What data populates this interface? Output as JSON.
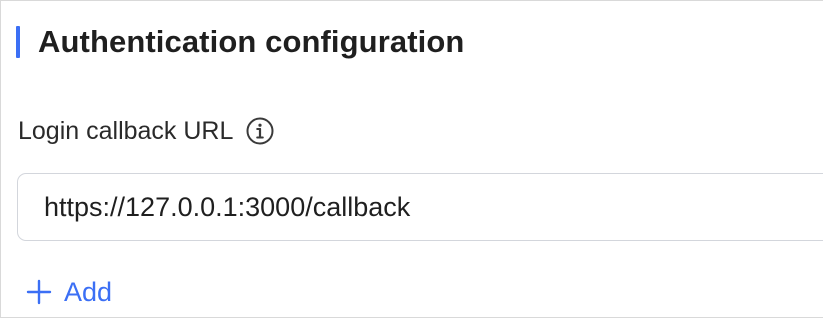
{
  "section": {
    "title": "Authentication configuration"
  },
  "login_callback": {
    "label": "Login callback URL",
    "info_icon": "info-circle-icon",
    "value": "https://127.0.0.1:3000/callback"
  },
  "actions": {
    "add_label": "Add",
    "add_icon": "plus-icon"
  },
  "colors": {
    "accent": "#3b6ff5",
    "text": "#1f1f1f",
    "border": "#d3d6dc"
  }
}
